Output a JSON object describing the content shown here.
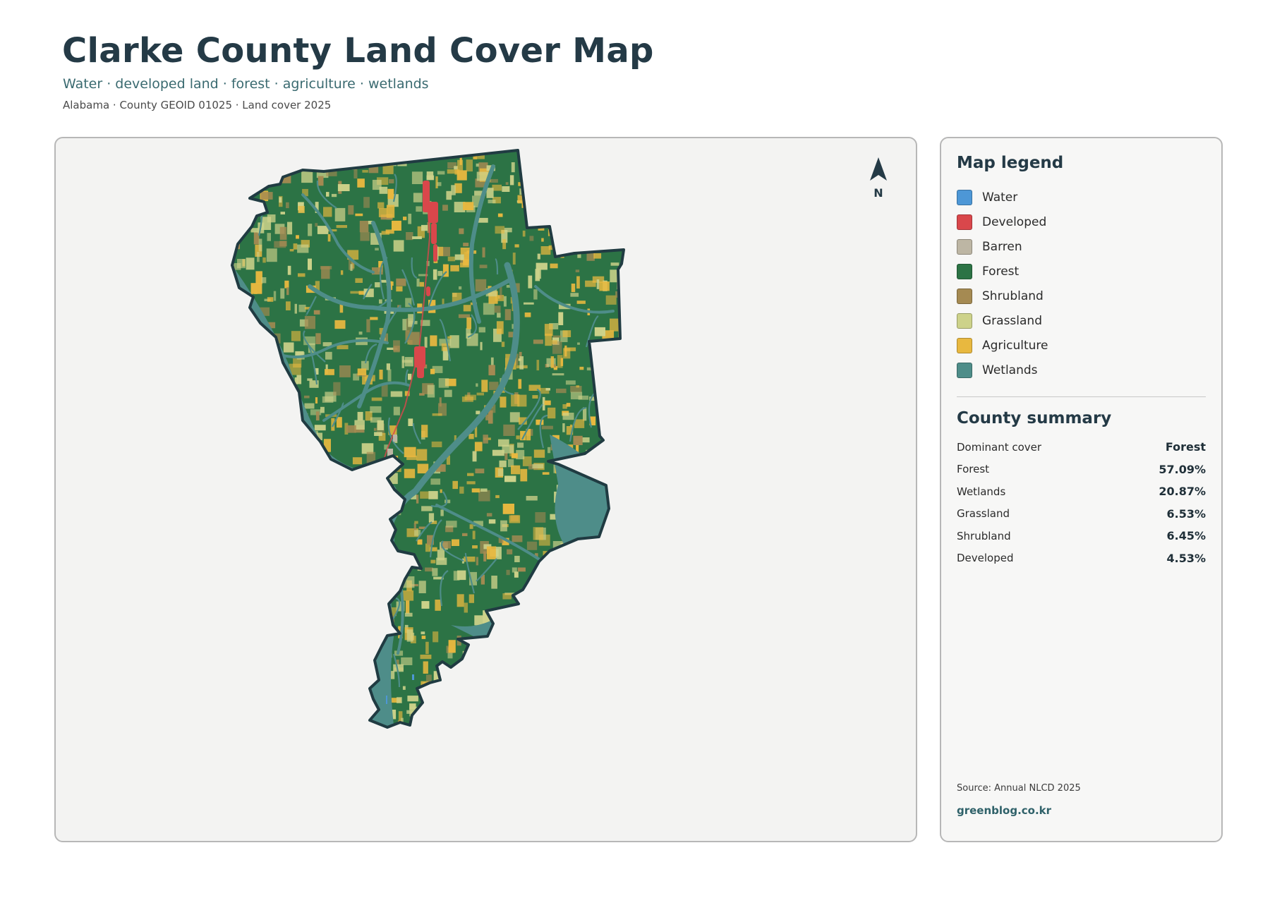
{
  "header": {
    "title": "Clarke County Land Cover Map",
    "subtitle": "Water · developed land · forest · agriculture · wetlands",
    "meta": "Alabama · County GEOID 01025 · Land cover 2025"
  },
  "map": {
    "north_label": "N",
    "colors": {
      "background": "#f3f3f2",
      "outline": "#203b42",
      "forest": "#2c7345",
      "wetlands": "#4e8d89",
      "developed": "#d9474b",
      "agriculture": "#e8b83f",
      "grassland": "#cdd28a",
      "shrubland": "#a58a52",
      "barren": "#bdb6a4",
      "water": "#4d97d6"
    }
  },
  "legend": {
    "title": "Map legend",
    "items": [
      {
        "label": "Water",
        "color": "#4d97d6"
      },
      {
        "label": "Developed",
        "color": "#d9474b"
      },
      {
        "label": "Barren",
        "color": "#bdb6a4"
      },
      {
        "label": "Forest",
        "color": "#2c7345"
      },
      {
        "label": "Shrubland",
        "color": "#a58a52"
      },
      {
        "label": "Grassland",
        "color": "#cdd28a"
      },
      {
        "label": "Agriculture",
        "color": "#e8b83f"
      },
      {
        "label": "Wetlands",
        "color": "#4e8d89"
      }
    ]
  },
  "summary": {
    "title": "County summary",
    "rows": [
      {
        "label": "Dominant cover",
        "value": "Forest"
      },
      {
        "label": "Forest",
        "value": "57.09%"
      },
      {
        "label": "Wetlands",
        "value": "20.87%"
      },
      {
        "label": "Grassland",
        "value": "6.53%"
      },
      {
        "label": "Shrubland",
        "value": "6.45%"
      },
      {
        "label": "Developed",
        "value": "4.53%"
      }
    ]
  },
  "footer": {
    "source": "Source: Annual NLCD 2025",
    "site": "greenblog.co.kr"
  }
}
